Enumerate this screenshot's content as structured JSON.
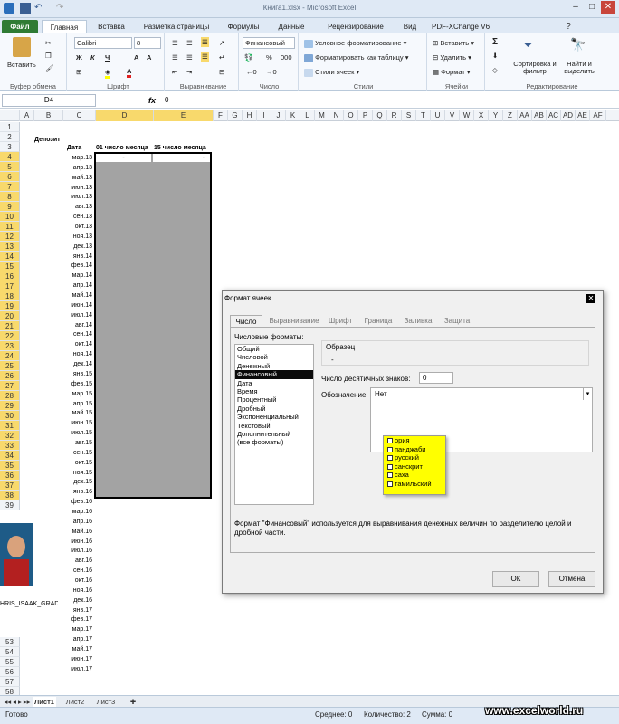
{
  "window": {
    "title": "Книга1.xlsx  -  Microsoft Excel"
  },
  "tabs": [
    "Файл",
    "Главная",
    "Вставка",
    "Разметка страницы",
    "Формулы",
    "Данные",
    "Рецензирование",
    "Вид",
    "PDF-XChange V6"
  ],
  "ribbon": {
    "clipboard": {
      "paste": "Вставить",
      "label": "Буфер обмена"
    },
    "font": {
      "name": "Calibri",
      "size": "8",
      "bold": "Ж",
      "italic": "К",
      "underline": "Ч",
      "label": "Шрифт"
    },
    "align": {
      "label": "Выравнивание"
    },
    "number": {
      "format": "Финансовый",
      "percent": "%",
      "thousands": "000",
      "label": "Число"
    },
    "styles": {
      "cond": "Условное форматирование",
      "table": "Форматировать как таблицу",
      "cell": "Стили ячеек",
      "label": "Стили"
    },
    "cells": {
      "insert": "Вставить",
      "delete": "Удалить",
      "format": "Формат",
      "label": "Ячейки"
    },
    "editing": {
      "sum": "Σ",
      "sort": "Сортировка и фильтр",
      "find": "Найти и выделить",
      "label": "Редактирование"
    }
  },
  "formula_bar": {
    "name_box": "D4",
    "fx": "fx",
    "value": "0"
  },
  "columns": [
    "A",
    "B",
    "C",
    "D",
    "E",
    "F",
    "G",
    "H",
    "I",
    "J",
    "K",
    "L",
    "M",
    "N",
    "O",
    "P",
    "Q",
    "R",
    "S",
    "T",
    "U",
    "V",
    "W",
    "X",
    "Y",
    "Z",
    "AA",
    "AB",
    "AC",
    "AD",
    "AE",
    "AF"
  ],
  "rows": [
    "1",
    "2",
    "3",
    "4",
    "5",
    "6",
    "7",
    "8",
    "9",
    "10",
    "11",
    "12",
    "13",
    "14",
    "15",
    "16",
    "17",
    "18",
    "19",
    "20",
    "21",
    "22",
    "23",
    "24",
    "25",
    "26",
    "27",
    "28",
    "29",
    "30",
    "31",
    "32",
    "33",
    "34",
    "35",
    "36",
    "37",
    "38",
    "39"
  ],
  "lower_rows": [
    "53",
    "54",
    "55",
    "56",
    "57",
    "58"
  ],
  "sheet": {
    "deposit": "Депозит",
    "h_date": "Дата",
    "h_d": "01 число месяца",
    "h_e": "15 число месяца",
    "d4": "-",
    "e4": "-",
    "dates": [
      "мар.13",
      "апр.13",
      "май.13",
      "июн.13",
      "июл.13",
      "авг.13",
      "сен.13",
      "окт.13",
      "ноя.13",
      "дек.13",
      "янв.14",
      "фев.14",
      "мар.14",
      "апр.14",
      "май.14",
      "июн.14",
      "июл.14",
      "авг.14",
      "сен.14",
      "окт.14",
      "ноя.14",
      "дек.14",
      "янв.15",
      "фев.15",
      "мар.15",
      "апр.15",
      "май.15",
      "июн.15",
      "июл.15",
      "авг.15",
      "сен.15",
      "окт.15",
      "ноя.15",
      "дек.15",
      "янв.16",
      "фев.16",
      "мар.16",
      "апр.16",
      "май.16",
      "июн.16",
      "июл.16",
      "авг.16",
      "сен.16",
      "окт.16",
      "ноя.16",
      "дек.16",
      "янв.17",
      "фев.17",
      "мар.17",
      "апр.17",
      "май.17",
      "июн.17",
      "июл.17"
    ]
  },
  "avatar": {
    "caption": "HRIS_ISAAK_GRAD"
  },
  "dialog": {
    "title": "Формат ячеек",
    "tabs": [
      "Число",
      "Выравнивание",
      "Шрифт",
      "Граница",
      "Заливка",
      "Защита"
    ],
    "formats_label": "Числовые форматы:",
    "formats": [
      "Общий",
      "Числовой",
      "Денежный",
      "Финансовый",
      "Дата",
      "Время",
      "Процентный",
      "Дробный",
      "Экспоненциальный",
      "Текстовый",
      "Дополнительный",
      "(все форматы)"
    ],
    "sample_label": "Образец",
    "sample_value": "-",
    "decimals_label": "Число десятичных знаков:",
    "decimals_value": "0",
    "symbol_label": "Обозначение:",
    "symbol_value": "Нет",
    "symbol_options": [
      "ория",
      "панджаби",
      "русский",
      "санскрит",
      "саха",
      "тамильский"
    ],
    "description": "Формат \"Финансовый\" используется для выравнивания денежных величин по разделителю целой и дробной части.",
    "ok": "ОК",
    "cancel": "Отмена"
  },
  "sheet_tabs": [
    "Лист1",
    "Лист2",
    "Лист3"
  ],
  "status": {
    "ready": "Готово",
    "avg": "Среднее: 0",
    "count": "Количество: 2",
    "sum": "Сумма: 0"
  },
  "watermark": "www.excelworld.ru",
  "colors": {
    "file_tab": "#2f7b34",
    "selection": "#a3a3a3",
    "popup": "#ffff00",
    "header_sel": "#f8d96c"
  }
}
